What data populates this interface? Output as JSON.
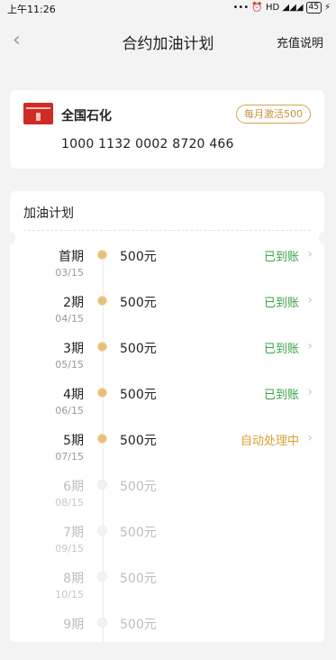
{
  "status_bar": {
    "time": "上午11:26",
    "icons": "••• ⏰ HD ◢◢◢",
    "battery": "45"
  },
  "nav": {
    "back_icon": "back-chevron-icon",
    "title": "合约加油计划",
    "action": "充值说明"
  },
  "card": {
    "company": "全国石化",
    "badge": "每月激活500",
    "number": "1000 1132 0002 8720 466",
    "brand_color": "#d02a24"
  },
  "plan": {
    "heading": "加油计划",
    "rows": [
      {
        "period": "首期",
        "date": "03/15",
        "amount": "500元",
        "status": "已到账",
        "state": "done"
      },
      {
        "period": "2期",
        "date": "04/15",
        "amount": "500元",
        "status": "已到账",
        "state": "done"
      },
      {
        "period": "3期",
        "date": "05/15",
        "amount": "500元",
        "status": "已到账",
        "state": "done"
      },
      {
        "period": "4期",
        "date": "06/15",
        "amount": "500元",
        "status": "已到账",
        "state": "done"
      },
      {
        "period": "5期",
        "date": "07/15",
        "amount": "500元",
        "status": "自动处理中",
        "state": "processing"
      },
      {
        "period": "6期",
        "date": "08/15",
        "amount": "500元",
        "status": "",
        "state": "future"
      },
      {
        "period": "7期",
        "date": "09/15",
        "amount": "500元",
        "status": "",
        "state": "future"
      },
      {
        "period": "8期",
        "date": "10/15",
        "amount": "500元",
        "status": "",
        "state": "future"
      },
      {
        "period": "9期",
        "date": "",
        "amount": "500元",
        "status": "",
        "state": "future"
      }
    ]
  },
  "colors": {
    "done": "#3aa34a",
    "processing": "#d9a233",
    "accent": "#c9923a"
  }
}
